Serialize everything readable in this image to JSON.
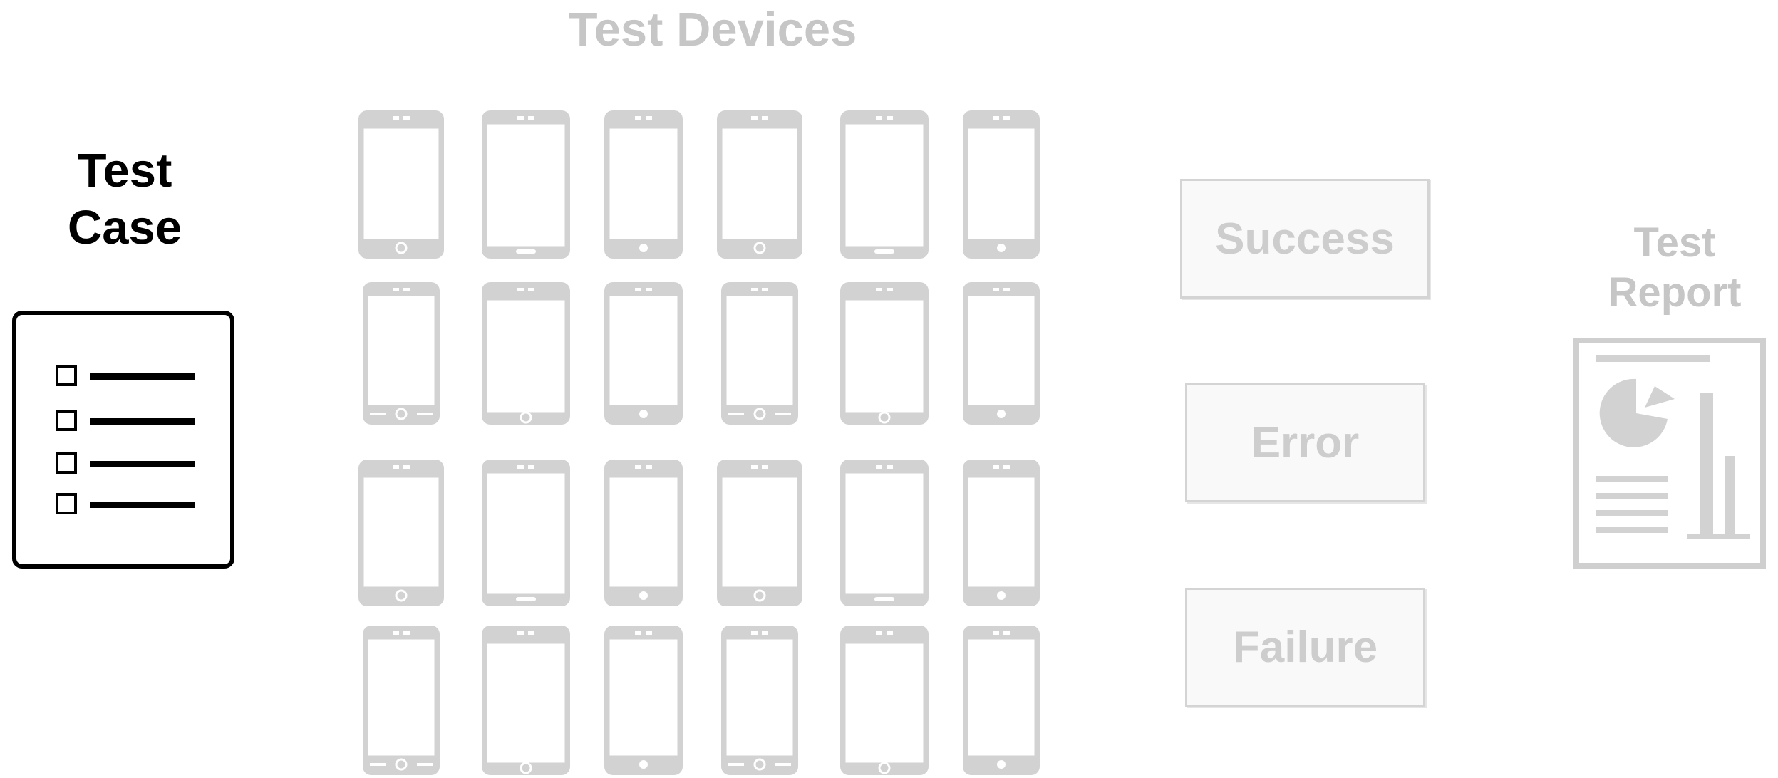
{
  "test_case": {
    "title_lines": [
      "Test",
      "Case"
    ],
    "icon": "checklist-icon",
    "checklist_items": 4
  },
  "test_devices": {
    "title": "Test Devices",
    "icon": "smartphone-icon",
    "rows": 4,
    "columns": 6
  },
  "results": {
    "items": [
      "Success",
      "Error",
      "Failure"
    ]
  },
  "test_report": {
    "title_lines": [
      "Test",
      "Report"
    ],
    "icon": "report-chart-icon"
  },
  "colors": {
    "primary": "#000000",
    "muted": "#c6c6c6",
    "muted_fill": "#d2d2d2",
    "box_fill": "#f9f9f9",
    "background": "#ffffff"
  }
}
